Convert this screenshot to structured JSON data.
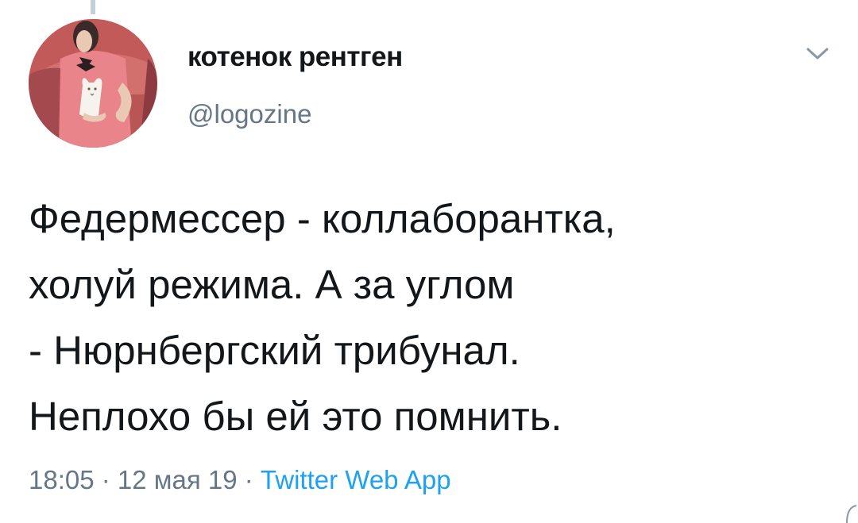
{
  "tweet": {
    "author": {
      "display_name": "котенок рентген",
      "handle": "@logozine"
    },
    "text": "Федермессер - коллаборантка,\nхолуй режима. А за углом\n- Нюрнбергский трибунал.\nНеплохо бы ей это помнить.",
    "time": "18:05",
    "date": "12 мая 19",
    "separator": " · ",
    "source": "Twitter Web App"
  },
  "icons": {
    "menu": "chevron-down-icon"
  },
  "colors": {
    "primary_text": "#14171a",
    "secondary_text": "#657786",
    "link": "#1da1f2",
    "thread_line": "#c4cfd6"
  }
}
